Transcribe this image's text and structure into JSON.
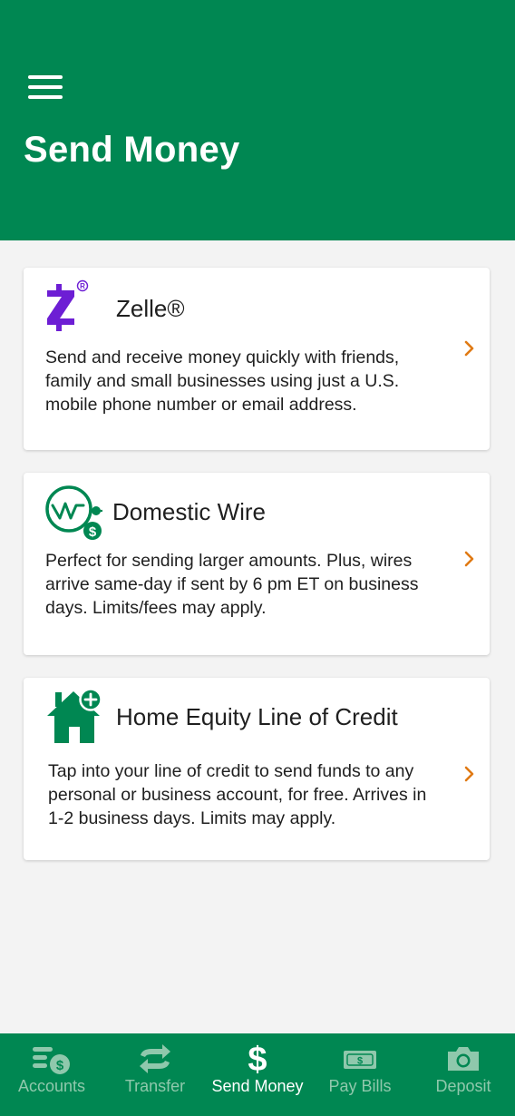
{
  "header": {
    "title": "Send Money"
  },
  "options": [
    {
      "title": "Zelle®",
      "description": "Send and receive money quickly with friends, family and small businesses using just a U.S. mobile phone number or email address.",
      "icon": "zelle-logo-icon"
    },
    {
      "title": "Domestic Wire",
      "description": "Perfect for sending larger amounts. Plus, wires arrive same-day if sent by 6 pm ET on business days. Limits/fees may apply.",
      "icon": "wire-transfer-icon"
    },
    {
      "title": "Home Equity Line of Credit",
      "description": "Tap into your line of credit to send funds to any personal or business account, for free. Arrives in 1-2 business days. Limits may apply.",
      "icon": "home-plus-icon"
    }
  ],
  "tabs": [
    {
      "label": "Accounts",
      "icon": "accounts-icon",
      "active": false
    },
    {
      "label": "Transfer",
      "icon": "transfer-icon",
      "active": false
    },
    {
      "label": "Send Money",
      "icon": "dollar-icon",
      "active": true
    },
    {
      "label": "Pay Bills",
      "icon": "bill-icon",
      "active": false
    },
    {
      "label": "Deposit",
      "icon": "camera-icon",
      "active": false
    }
  ],
  "colors": {
    "brand_green": "#008752",
    "zelle_purple": "#6d1ed4",
    "chevron_orange": "#e07a14",
    "tab_inactive": "#8fc8ac"
  }
}
